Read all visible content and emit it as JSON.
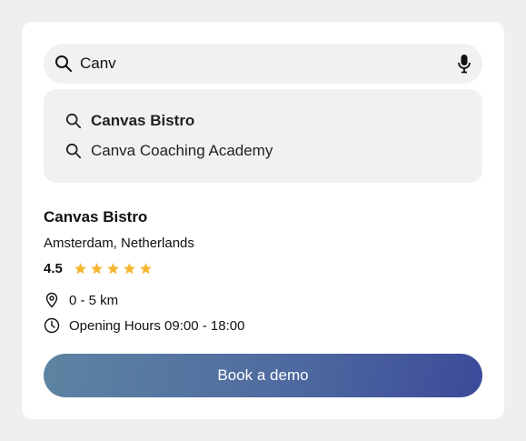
{
  "search": {
    "query": "Canv",
    "icon": "search-icon",
    "mic_icon": "microphone-icon"
  },
  "suggestions": [
    {
      "label": "Canvas Bistro",
      "bold": true
    },
    {
      "label": "Canva Coaching Academy",
      "bold": false
    }
  ],
  "place": {
    "name": "Canvas Bistro",
    "location": "Amsterdam, Netherlands",
    "rating": "4.5",
    "stars": 5,
    "distance": "0 - 5 km",
    "hours": "Opening Hours 09:00 - 18:00"
  },
  "cta": {
    "label": "Book a demo"
  },
  "colors": {
    "star": "#f5b731",
    "cta_start": "#5d84a2",
    "cta_end": "#3c4a9a",
    "panel_bg": "#f1f1f1"
  }
}
